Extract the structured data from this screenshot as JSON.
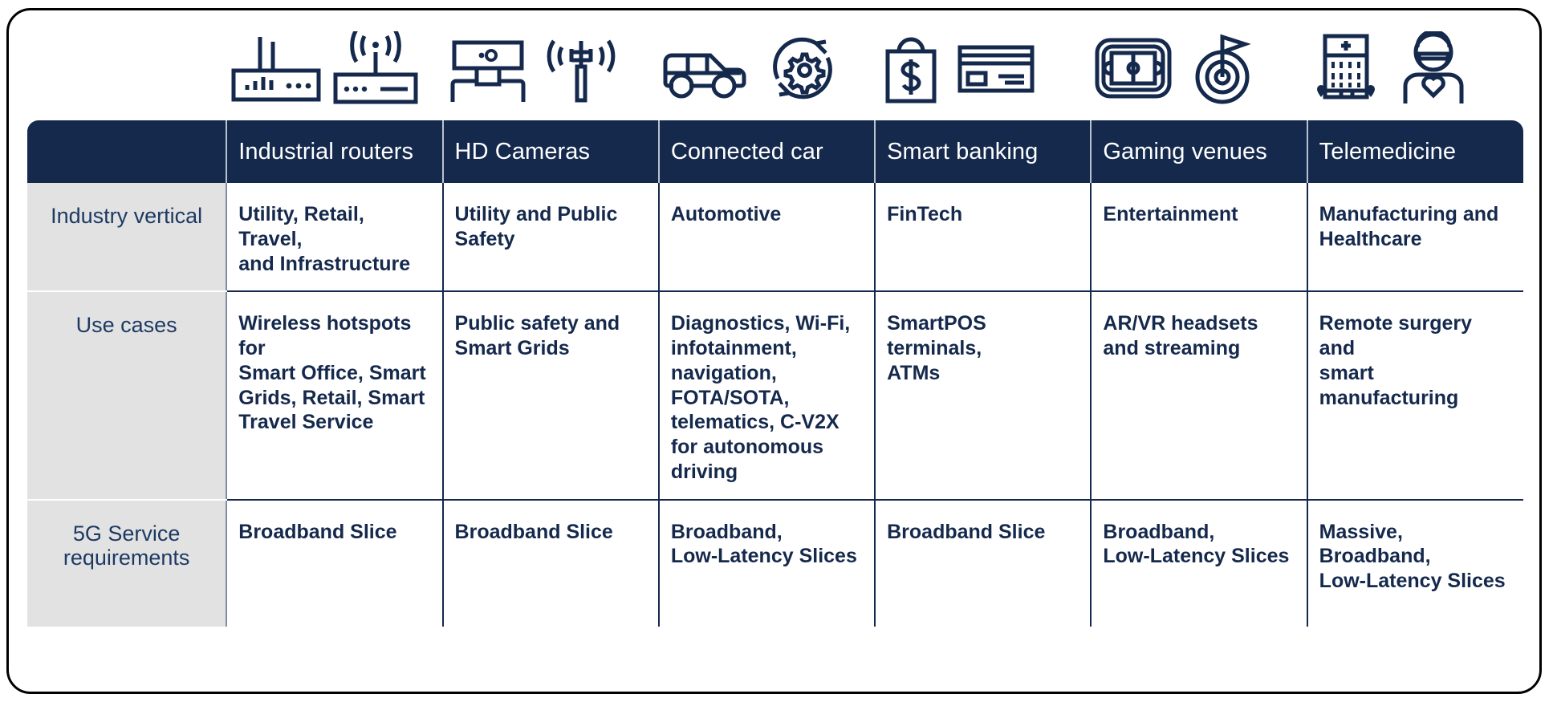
{
  "icons": [
    {
      "name": "industrial-router-antenna-icon",
      "label": "router with signal bars"
    },
    {
      "name": "wireless-router-broadcast-icon",
      "label": "router broadcasting wireless"
    },
    {
      "name": "hd-camera-icon",
      "label": "HD webcam on stand"
    },
    {
      "name": "cell-tower-signal-icon",
      "label": "cell tower transmitting"
    },
    {
      "name": "car-icon",
      "label": "connected car"
    },
    {
      "name": "gear-refresh-cycle-icon",
      "label": "gear inside refresh arrows"
    },
    {
      "name": "shopping-bag-dollar-icon",
      "label": "shopping bag with dollar sign"
    },
    {
      "name": "credit-card-icon",
      "label": "credit card"
    },
    {
      "name": "stadium-venue-icon",
      "label": "sports venue / stadium screen"
    },
    {
      "name": "target-flag-icon",
      "label": "target with flag"
    },
    {
      "name": "hospital-building-icon",
      "label": "hospital building with cross"
    },
    {
      "name": "doctor-mask-heart-icon",
      "label": "doctor wearing mask with heart"
    }
  ],
  "table": {
    "corner_label": "",
    "columns": [
      "Industrial routers",
      "HD Cameras",
      "Connected car",
      "Smart banking",
      "Gaming venues",
      "Telemedicine"
    ],
    "rows": [
      {
        "label": "Industry\nvertical",
        "cells": [
          "Utility, Retail, Travel,\nand Infrastructure",
          "Utility and Public\nSafety",
          "Automotive",
          "FinTech",
          "Entertainment",
          "Manufacturing and\nHealthcare"
        ]
      },
      {
        "label": "Use\ncases",
        "cells": [
          "Wireless hotspots for\nSmart Office, Smart\nGrids, Retail, Smart\nTravel Service",
          "Public safety and\nSmart Grids",
          "Diagnostics, Wi-Fi,\ninfotainment,\nnavigation,\nFOTA/SOTA,\ntelematics, C-V2X\nfor autonomous\ndriving",
          "SmartPOS terminals,\nATMs",
          "AR/VR headsets\nand streaming",
          "Remote surgery and\nsmart manufacturing"
        ]
      },
      {
        "label": "5G Service\nrequirements",
        "cells": [
          "Broadband Slice",
          "Broadband Slice",
          "Broadband,\nLow-Latency Slices",
          "Broadband Slice",
          "Broadband,\nLow-Latency Slices",
          "Massive, Broadband,\nLow-Latency Slices"
        ]
      }
    ]
  },
  "colors": {
    "header_navy": "#15294d",
    "row_label_gray": "#e2e2e2",
    "text_navy": "#15294d",
    "frame_black": "#000000"
  }
}
